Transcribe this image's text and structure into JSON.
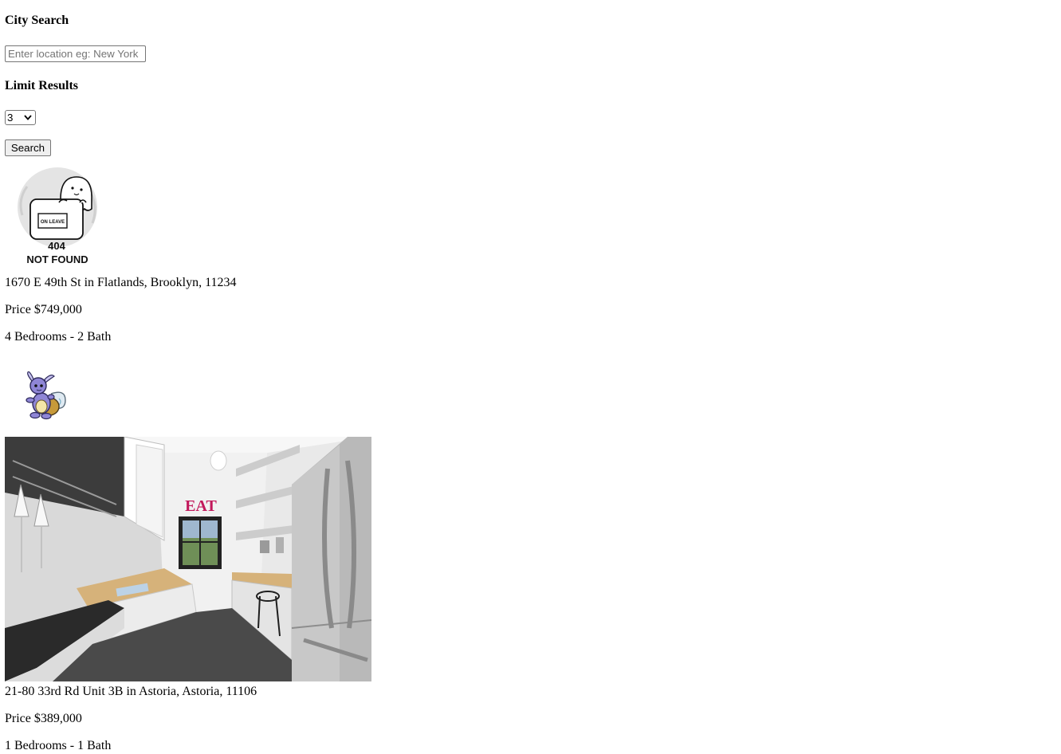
{
  "search": {
    "heading": "City Search",
    "placeholder": "Enter location eg: New York",
    "value": ""
  },
  "limit": {
    "heading": "Limit Results",
    "selected": "3"
  },
  "search_button": {
    "label": "Search"
  },
  "listings": [
    {
      "image_alt": "404 NOT FOUND",
      "image_text_small": "ON LEAVE",
      "image_text_code": "404",
      "image_text_caption": "NOT FOUND",
      "address": "1670 E 49th St in Flatlands, Brooklyn, 11234",
      "price": "Price $749,000",
      "rooms": "4 Bedrooms - 2 Bath"
    },
    {
      "image_alt": "Kitchen photo",
      "image_sign": "EAT",
      "address": "21-80 33rd Rd Unit 3B in Astoria, Astoria, 11106",
      "price": "Price $389,000",
      "rooms": "1 Bedrooms - 1 Bath"
    }
  ],
  "colors": {
    "eat_sign": "#c2185b",
    "pokemon_body": "#8f86d6",
    "pokemon_shell": "#c79a3a"
  }
}
